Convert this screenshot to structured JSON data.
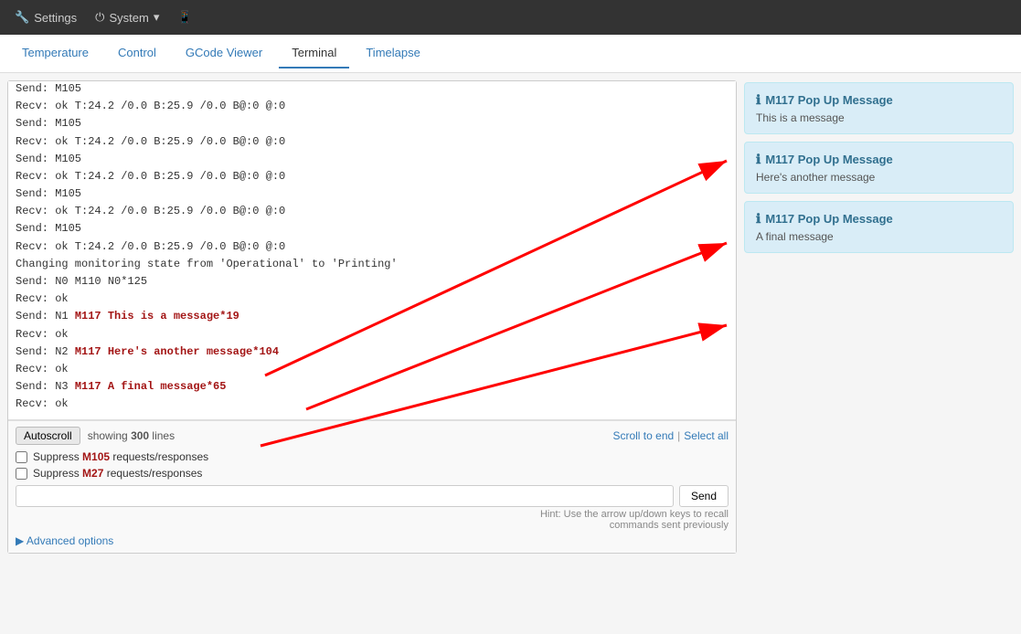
{
  "navbar": {
    "settings_label": "Settings",
    "system_label": "System",
    "mobile_label": "",
    "settings_icon": "🔧",
    "system_icon": "⏻",
    "mobile_icon": "📱",
    "dropdown_icon": "▾"
  },
  "tabs": [
    {
      "id": "temperature",
      "label": "Temperature",
      "active": false
    },
    {
      "id": "control",
      "label": "Control",
      "active": false
    },
    {
      "id": "gcode",
      "label": "GCode Viewer",
      "active": false
    },
    {
      "id": "terminal",
      "label": "Terminal",
      "active": true
    },
    {
      "id": "timelapse",
      "label": "Timelapse",
      "active": false
    }
  ],
  "terminal": {
    "lines": [
      {
        "type": "recv",
        "text": "Recv: ok T:24.2 /0.0 B:25.9 /0.0 B@:0 @:0"
      },
      {
        "type": "send",
        "text": "Send: M105"
      },
      {
        "type": "recv",
        "text": "Recv: ok T:24.2 /0.0 B:25.9 /0.0 B@:0 @:0"
      },
      {
        "type": "send",
        "text": "Send: M105"
      },
      {
        "type": "recv",
        "text": "Recv: ok T:24.2 /0.0 B:25.9 /0.0 B@:0 @:0"
      },
      {
        "type": "send",
        "text": "Send: M105"
      },
      {
        "type": "recv",
        "text": "Recv: ok T:24.2 /0.0 B:25.9 /0.0 B@:0 @:0"
      },
      {
        "type": "send",
        "text": "Send: M105"
      },
      {
        "type": "recv",
        "text": "Recv: ok T:24.2 /0.0 B:25.9 /0.0 B@:0 @:0"
      },
      {
        "type": "send",
        "text": "Send: M105"
      },
      {
        "type": "recv",
        "text": "Recv: ok T:24.2 /0.0 B:25.9 /0.0 B@:0 @:0"
      },
      {
        "type": "send",
        "text": "Send: M105"
      },
      {
        "type": "recv",
        "text": "Recv: ok T:24.2 /0.0 B:25.9 /0.0 B@:0 @:0"
      },
      {
        "type": "send",
        "text": "Send: M105"
      },
      {
        "type": "recv",
        "text": "Recv: ok T:24.2 /0.0 B:25.9 /0.0 B@:0 @:0"
      },
      {
        "type": "special",
        "text": "Changing monitoring state from 'Operational' to 'Printing'"
      },
      {
        "type": "send",
        "text": "Send: N0 M110 N0*125"
      },
      {
        "type": "recv",
        "text": "Recv: ok"
      },
      {
        "type": "send_highlight",
        "text": "Send: N1 M117 This is a message*19"
      },
      {
        "type": "recv",
        "text": "Recv: ok"
      },
      {
        "type": "send_highlight",
        "text": "Send: N2 M117 Here's another message*104"
      },
      {
        "type": "recv",
        "text": "Recv: ok"
      },
      {
        "type": "send_highlight",
        "text": "Send: N3 M117 A final message*65"
      },
      {
        "type": "recv",
        "text": "Recv: ok"
      }
    ],
    "line_count": "300",
    "showing_label": "showing",
    "lines_label": "lines",
    "scroll_to_end": "Scroll to end",
    "select_all": "Select all",
    "autoscroll_label": "Autoscroll",
    "suppress_m105_label": "Suppress",
    "suppress_m105_highlight": "M105",
    "suppress_m105_suffix": "requests/responses",
    "suppress_m27_label": "Suppress",
    "suppress_m27_highlight": "M27",
    "suppress_m27_suffix": "requests/responses",
    "send_placeholder": "",
    "send_btn_label": "Send",
    "hint_line1": "Hint: Use the arrow up/down keys to recall",
    "hint_line2": "commands sent previously",
    "advanced_options": "▶ Advanced options"
  },
  "notifications": [
    {
      "id": "notif1",
      "icon": "ℹ",
      "title": "M117 Pop Up Message",
      "body": "This is a message"
    },
    {
      "id": "notif2",
      "icon": "ℹ",
      "title": "M117 Pop Up Message",
      "body": "Here's another message"
    },
    {
      "id": "notif3",
      "icon": "ℹ",
      "title": "M117 Pop Up Message",
      "body": "A final message"
    }
  ]
}
